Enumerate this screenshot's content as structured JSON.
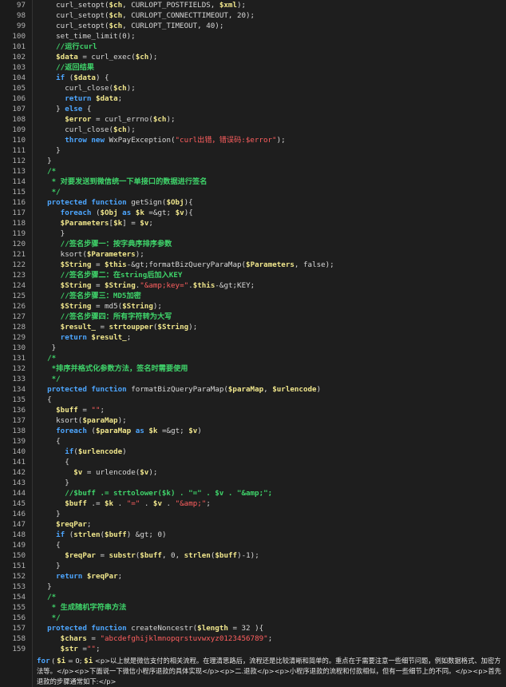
{
  "editor": {
    "lines": [
      {
        "n": "97",
        "t": [
          [
            "p",
            "    curl_setopt("
          ],
          [
            "v",
            "$ch"
          ],
          [
            "p",
            ", CURLOPT_POSTFIELDS, "
          ],
          [
            "v",
            "$xml"
          ],
          [
            "p",
            ");"
          ]
        ]
      },
      {
        "n": "98",
        "t": [
          [
            "p",
            "    curl_setopt("
          ],
          [
            "v",
            "$ch"
          ],
          [
            "p",
            ", CURLOPT_CONNECTTIMEOUT, 20);"
          ]
        ]
      },
      {
        "n": "99",
        "t": [
          [
            "p",
            "    curl_setopt("
          ],
          [
            "v",
            "$ch"
          ],
          [
            "p",
            ", CURLOPT_TIMEOUT, 40);"
          ]
        ]
      },
      {
        "n": "100",
        "t": [
          [
            "p",
            "    set_time_limit(0);"
          ]
        ]
      },
      {
        "n": "101",
        "t": [
          [
            "c",
            "    //运行curl"
          ]
        ]
      },
      {
        "n": "102",
        "t": [
          [
            "p",
            "    "
          ],
          [
            "v",
            "$data"
          ],
          [
            "p",
            " = curl_exec("
          ],
          [
            "v",
            "$ch"
          ],
          [
            "p",
            ");"
          ]
        ]
      },
      {
        "n": "103",
        "t": [
          [
            "c",
            "    //返回结果"
          ]
        ]
      },
      {
        "n": "104",
        "t": [
          [
            "p",
            "    "
          ],
          [
            "k",
            "if"
          ],
          [
            "p",
            " ("
          ],
          [
            "v",
            "$data"
          ],
          [
            "p",
            ") {"
          ]
        ]
      },
      {
        "n": "105",
        "t": [
          [
            "p",
            "      curl_close("
          ],
          [
            "v",
            "$ch"
          ],
          [
            "p",
            ");"
          ]
        ]
      },
      {
        "n": "106",
        "t": [
          [
            "p",
            "      "
          ],
          [
            "k",
            "return"
          ],
          [
            "p",
            " "
          ],
          [
            "v",
            "$data"
          ],
          [
            "p",
            ";"
          ]
        ]
      },
      {
        "n": "107",
        "t": [
          [
            "p",
            "    } "
          ],
          [
            "k",
            "else"
          ],
          [
            "p",
            " {"
          ]
        ]
      },
      {
        "n": "108",
        "t": [
          [
            "p",
            "      "
          ],
          [
            "v",
            "$error"
          ],
          [
            "p",
            " = curl_errno("
          ],
          [
            "v",
            "$ch"
          ],
          [
            "p",
            ");"
          ]
        ]
      },
      {
        "n": "109",
        "t": [
          [
            "p",
            "      curl_close("
          ],
          [
            "v",
            "$ch"
          ],
          [
            "p",
            ");"
          ]
        ]
      },
      {
        "n": "110",
        "t": [
          [
            "p",
            "      "
          ],
          [
            "k",
            "throw new"
          ],
          [
            "p",
            " WxPayException("
          ],
          [
            "s",
            "\"curl出错，错误码:$error\""
          ],
          [
            "p",
            ");"
          ]
        ]
      },
      {
        "n": "111",
        "t": [
          [
            "p",
            "    }"
          ]
        ]
      },
      {
        "n": "112",
        "t": [
          [
            "p",
            "  }"
          ]
        ]
      },
      {
        "n": "113",
        "t": [
          [
            "c",
            "  /*"
          ]
        ]
      },
      {
        "n": "114",
        "t": [
          [
            "c",
            "   * 对要发送到微信统一下单接口的数据进行签名"
          ]
        ]
      },
      {
        "n": "115",
        "t": [
          [
            "c",
            "   */"
          ]
        ]
      },
      {
        "n": "116",
        "t": [
          [
            "p",
            "  "
          ],
          [
            "k",
            "protected function"
          ],
          [
            "p",
            " getSign("
          ],
          [
            "v",
            "$Obj"
          ],
          [
            "p",
            "){"
          ]
        ]
      },
      {
        "n": "117",
        "t": [
          [
            "p",
            "     "
          ],
          [
            "k",
            "foreach"
          ],
          [
            "p",
            " ("
          ],
          [
            "v",
            "$Obj"
          ],
          [
            "p",
            " "
          ],
          [
            "k",
            "as"
          ],
          [
            "p",
            " "
          ],
          [
            "v",
            "$k"
          ],
          [
            "p",
            " =&gt; "
          ],
          [
            "v",
            "$v"
          ],
          [
            "p",
            "){"
          ]
        ]
      },
      {
        "n": "118",
        "t": [
          [
            "p",
            "     "
          ],
          [
            "v",
            "$Parameters"
          ],
          [
            "p",
            "["
          ],
          [
            "v",
            "$k"
          ],
          [
            "p",
            "] = "
          ],
          [
            "v",
            "$v"
          ],
          [
            "p",
            ";"
          ]
        ]
      },
      {
        "n": "119",
        "t": [
          [
            "p",
            "     }"
          ]
        ]
      },
      {
        "n": "120",
        "t": [
          [
            "c",
            "     //签名步骤一：按字典序排序参数"
          ]
        ]
      },
      {
        "n": "121",
        "t": [
          [
            "p",
            "     ksort("
          ],
          [
            "v",
            "$Parameters"
          ],
          [
            "p",
            ");"
          ]
        ]
      },
      {
        "n": "122",
        "t": [
          [
            "p",
            "     "
          ],
          [
            "v",
            "$String"
          ],
          [
            "p",
            " = "
          ],
          [
            "v",
            "$this"
          ],
          [
            "p",
            "-&gt;formatBizQueryParaMap("
          ],
          [
            "v",
            "$Parameters"
          ],
          [
            "p",
            ", false);"
          ]
        ]
      },
      {
        "n": "123",
        "t": [
          [
            "c",
            "     //签名步骤二：在string后加入KEY"
          ]
        ]
      },
      {
        "n": "124",
        "t": [
          [
            "p",
            "     "
          ],
          [
            "v",
            "$String"
          ],
          [
            "p",
            " = "
          ],
          [
            "v",
            "$String"
          ],
          [
            "p",
            "."
          ],
          [
            "s",
            "\"&amp;key=\""
          ],
          [
            "p",
            "."
          ],
          [
            "v",
            "$this"
          ],
          [
            "p",
            "-&gt;KEY;"
          ]
        ]
      },
      {
        "n": "125",
        "t": [
          [
            "c",
            "     //签名步骤三：MD5加密"
          ]
        ]
      },
      {
        "n": "126",
        "t": [
          [
            "p",
            "     "
          ],
          [
            "v",
            "$String"
          ],
          [
            "p",
            " = md5("
          ],
          [
            "v",
            "$String"
          ],
          [
            "p",
            ");"
          ]
        ]
      },
      {
        "n": "127",
        "t": [
          [
            "c",
            "     //签名步骤四：所有字符转为大写"
          ]
        ]
      },
      {
        "n": "128",
        "t": [
          [
            "p",
            "     "
          ],
          [
            "v",
            "$result_"
          ],
          [
            "p",
            " = "
          ],
          [
            "f",
            "strtoupper"
          ],
          [
            "p",
            "("
          ],
          [
            "v",
            "$String"
          ],
          [
            "p",
            ");"
          ]
        ]
      },
      {
        "n": "129",
        "t": [
          [
            "p",
            "     "
          ],
          [
            "k",
            "return"
          ],
          [
            "p",
            " "
          ],
          [
            "v",
            "$result_"
          ],
          [
            "p",
            ";"
          ]
        ]
      },
      {
        "n": "130",
        "t": [
          [
            "p",
            "   }"
          ]
        ]
      },
      {
        "n": "131",
        "t": [
          [
            "c",
            "  /*"
          ]
        ]
      },
      {
        "n": "132",
        "t": [
          [
            "c",
            "   *排序并格式化参数方法，签名时需要使用"
          ]
        ]
      },
      {
        "n": "133",
        "t": [
          [
            "c",
            "   */"
          ]
        ]
      },
      {
        "n": "134",
        "t": [
          [
            "p",
            "  "
          ],
          [
            "k",
            "protected function"
          ],
          [
            "p",
            " formatBizQueryParaMap("
          ],
          [
            "v",
            "$paraMap"
          ],
          [
            "p",
            ", "
          ],
          [
            "v",
            "$urlencode"
          ],
          [
            "p",
            ")"
          ]
        ]
      },
      {
        "n": "135",
        "t": [
          [
            "p",
            "  {"
          ]
        ]
      },
      {
        "n": "136",
        "t": [
          [
            "p",
            "    "
          ],
          [
            "v",
            "$buff"
          ],
          [
            "p",
            " = "
          ],
          [
            "s",
            "\"\""
          ],
          [
            "p",
            ";"
          ]
        ]
      },
      {
        "n": "137",
        "t": [
          [
            "p",
            "    ksort("
          ],
          [
            "v",
            "$paraMap"
          ],
          [
            "p",
            ");"
          ]
        ]
      },
      {
        "n": "138",
        "t": [
          [
            "p",
            "    "
          ],
          [
            "k",
            "foreach"
          ],
          [
            "p",
            " ("
          ],
          [
            "v",
            "$paraMap"
          ],
          [
            "p",
            " "
          ],
          [
            "k",
            "as"
          ],
          [
            "p",
            " "
          ],
          [
            "v",
            "$k"
          ],
          [
            "p",
            " =&gt; "
          ],
          [
            "v",
            "$v"
          ],
          [
            "p",
            ")"
          ]
        ]
      },
      {
        "n": "139",
        "t": [
          [
            "p",
            "    {"
          ]
        ]
      },
      {
        "n": "140",
        "t": [
          [
            "p",
            "      "
          ],
          [
            "k",
            "if"
          ],
          [
            "p",
            "("
          ],
          [
            "v",
            "$urlencode"
          ],
          [
            "p",
            ")"
          ]
        ]
      },
      {
        "n": "141",
        "t": [
          [
            "p",
            "      {"
          ]
        ]
      },
      {
        "n": "142",
        "t": [
          [
            "p",
            "        "
          ],
          [
            "v",
            "$v"
          ],
          [
            "p",
            " = urlencode("
          ],
          [
            "v",
            "$v"
          ],
          [
            "p",
            ");"
          ]
        ]
      },
      {
        "n": "143",
        "t": [
          [
            "p",
            "      }"
          ]
        ]
      },
      {
        "n": "144",
        "t": [
          [
            "c",
            "      //$buff .= strtolower($k) . \"=\" . $v . \"&amp;\";"
          ]
        ]
      },
      {
        "n": "145",
        "t": [
          [
            "p",
            "      "
          ],
          [
            "v",
            "$buff"
          ],
          [
            "p",
            " .= "
          ],
          [
            "v",
            "$k"
          ],
          [
            "p",
            " . "
          ],
          [
            "s",
            "\"=\""
          ],
          [
            "p",
            " . "
          ],
          [
            "v",
            "$v"
          ],
          [
            "p",
            " . "
          ],
          [
            "s",
            "\"&amp;\""
          ],
          [
            "p",
            ";"
          ]
        ]
      },
      {
        "n": "146",
        "t": [
          [
            "p",
            "    }"
          ]
        ]
      },
      {
        "n": "147",
        "t": [
          [
            "p",
            "    "
          ],
          [
            "v",
            "$reqPar"
          ],
          [
            "p",
            ";"
          ]
        ]
      },
      {
        "n": "148",
        "t": [
          [
            "p",
            "    "
          ],
          [
            "k",
            "if"
          ],
          [
            "p",
            " ("
          ],
          [
            "f",
            "strlen"
          ],
          [
            "p",
            "("
          ],
          [
            "v",
            "$buff"
          ],
          [
            "p",
            ") &gt; 0)"
          ]
        ]
      },
      {
        "n": "149",
        "t": [
          [
            "p",
            "    {"
          ]
        ]
      },
      {
        "n": "150",
        "t": [
          [
            "p",
            "      "
          ],
          [
            "v",
            "$reqPar"
          ],
          [
            "p",
            " = "
          ],
          [
            "f",
            "substr"
          ],
          [
            "p",
            "("
          ],
          [
            "v",
            "$buff"
          ],
          [
            "p",
            ", 0, "
          ],
          [
            "f",
            "strlen"
          ],
          [
            "p",
            "("
          ],
          [
            "v",
            "$buff"
          ],
          [
            "p",
            ")-1);"
          ]
        ]
      },
      {
        "n": "151",
        "t": [
          [
            "p",
            "    }"
          ]
        ]
      },
      {
        "n": "152",
        "t": [
          [
            "p",
            "    "
          ],
          [
            "k",
            "return"
          ],
          [
            "p",
            " "
          ],
          [
            "v",
            "$reqPar"
          ],
          [
            "p",
            ";"
          ]
        ]
      },
      {
        "n": "153",
        "t": [
          [
            "p",
            "  }"
          ]
        ]
      },
      {
        "n": "154",
        "t": [
          [
            "c",
            "  /*"
          ]
        ]
      },
      {
        "n": "155",
        "t": [
          [
            "c",
            "   * 生成随机字符串方法"
          ]
        ]
      },
      {
        "n": "156",
        "t": [
          [
            "c",
            "   */"
          ]
        ]
      },
      {
        "n": "157",
        "t": [
          [
            "p",
            "  "
          ],
          [
            "k",
            "protected function"
          ],
          [
            "p",
            " createNoncestr("
          ],
          [
            "v",
            "$length"
          ],
          [
            "p",
            " = 32 ){"
          ]
        ]
      },
      {
        "n": "158",
        "t": [
          [
            "p",
            "     "
          ],
          [
            "v",
            "$chars"
          ],
          [
            "p",
            " = "
          ],
          [
            "s",
            "\"abcdefghijklmnopqrstuvwxyz0123456789\""
          ],
          [
            "p",
            ";"
          ]
        ]
      },
      {
        "n": "159",
        "t": [
          [
            "p",
            "     "
          ],
          [
            "v",
            "$str"
          ],
          [
            "p",
            " ="
          ],
          [
            "s",
            "\"\""
          ],
          [
            "p",
            ";"
          ]
        ]
      }
    ],
    "tail": {
      "keyword": "for",
      "open": " ( ",
      "var_i": "$i",
      "mid": " = 0; ",
      "var_i2": "$i",
      "text": " <p>以上就是微信支付的相关流程。在理清思路后，流程还是比较清晰和简单的。重点在于需要注意一些细节问题，例如数据格式、加密方法等。</p><p>下面说一下微信小程序退款的具体实现</p><p>二.退款</p><p>小程序退款的流程和付款相似，但有一些细节上的不同。</p><p>首先退款的步骤通常如下:</p>"
    }
  }
}
